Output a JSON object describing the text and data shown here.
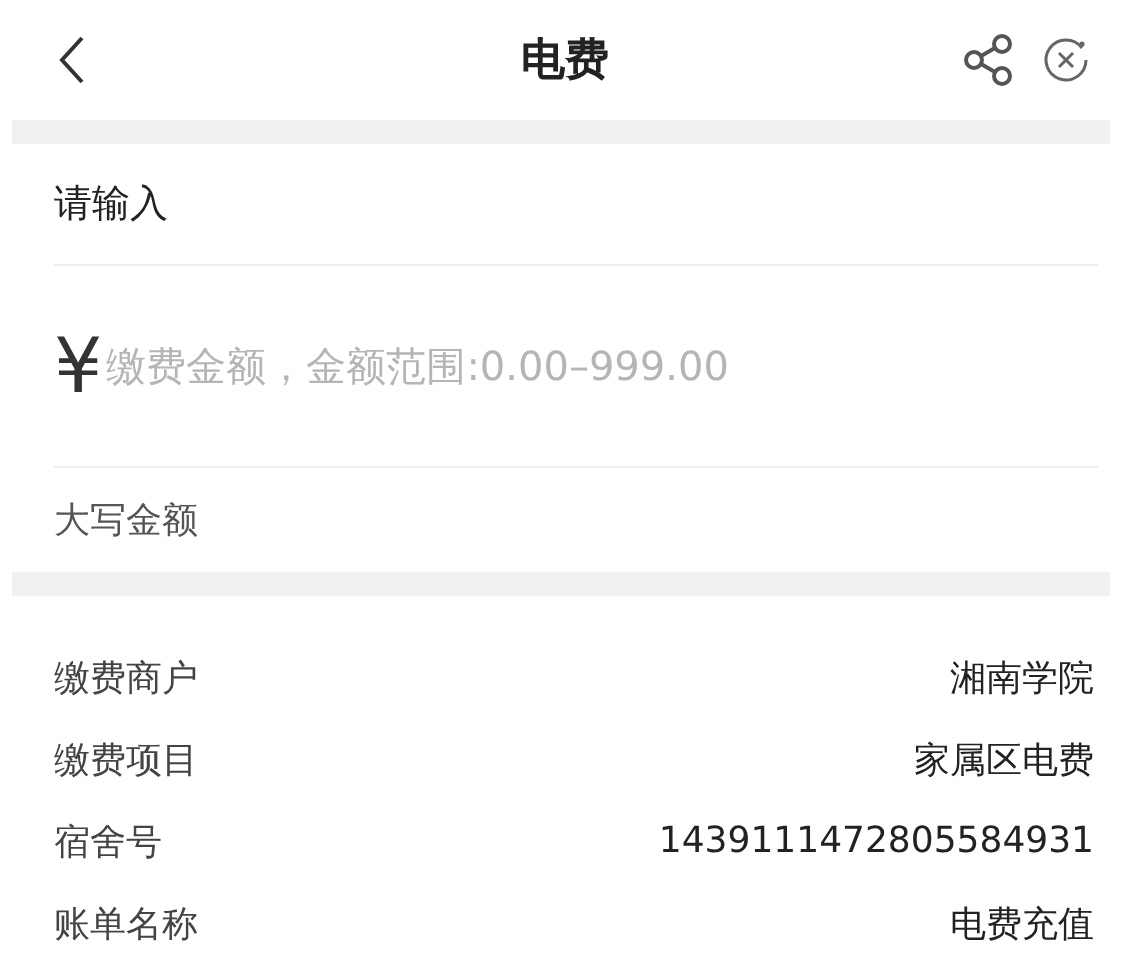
{
  "header": {
    "title": "电费"
  },
  "input_section": {
    "heading": "请输入",
    "currency": "¥",
    "amount": {
      "placeholder": "缴费金额，金额范围:0.00–999.00"
    },
    "uppercase_label": "大写金额"
  },
  "details": [
    {
      "label": "缴费商户",
      "value": "湘南学院"
    },
    {
      "label": "缴费项目",
      "value": "家属区电费"
    },
    {
      "label": "宿舍号",
      "value": "1439111472805584931"
    },
    {
      "label": "账单名称",
      "value": "电费充值"
    }
  ]
}
